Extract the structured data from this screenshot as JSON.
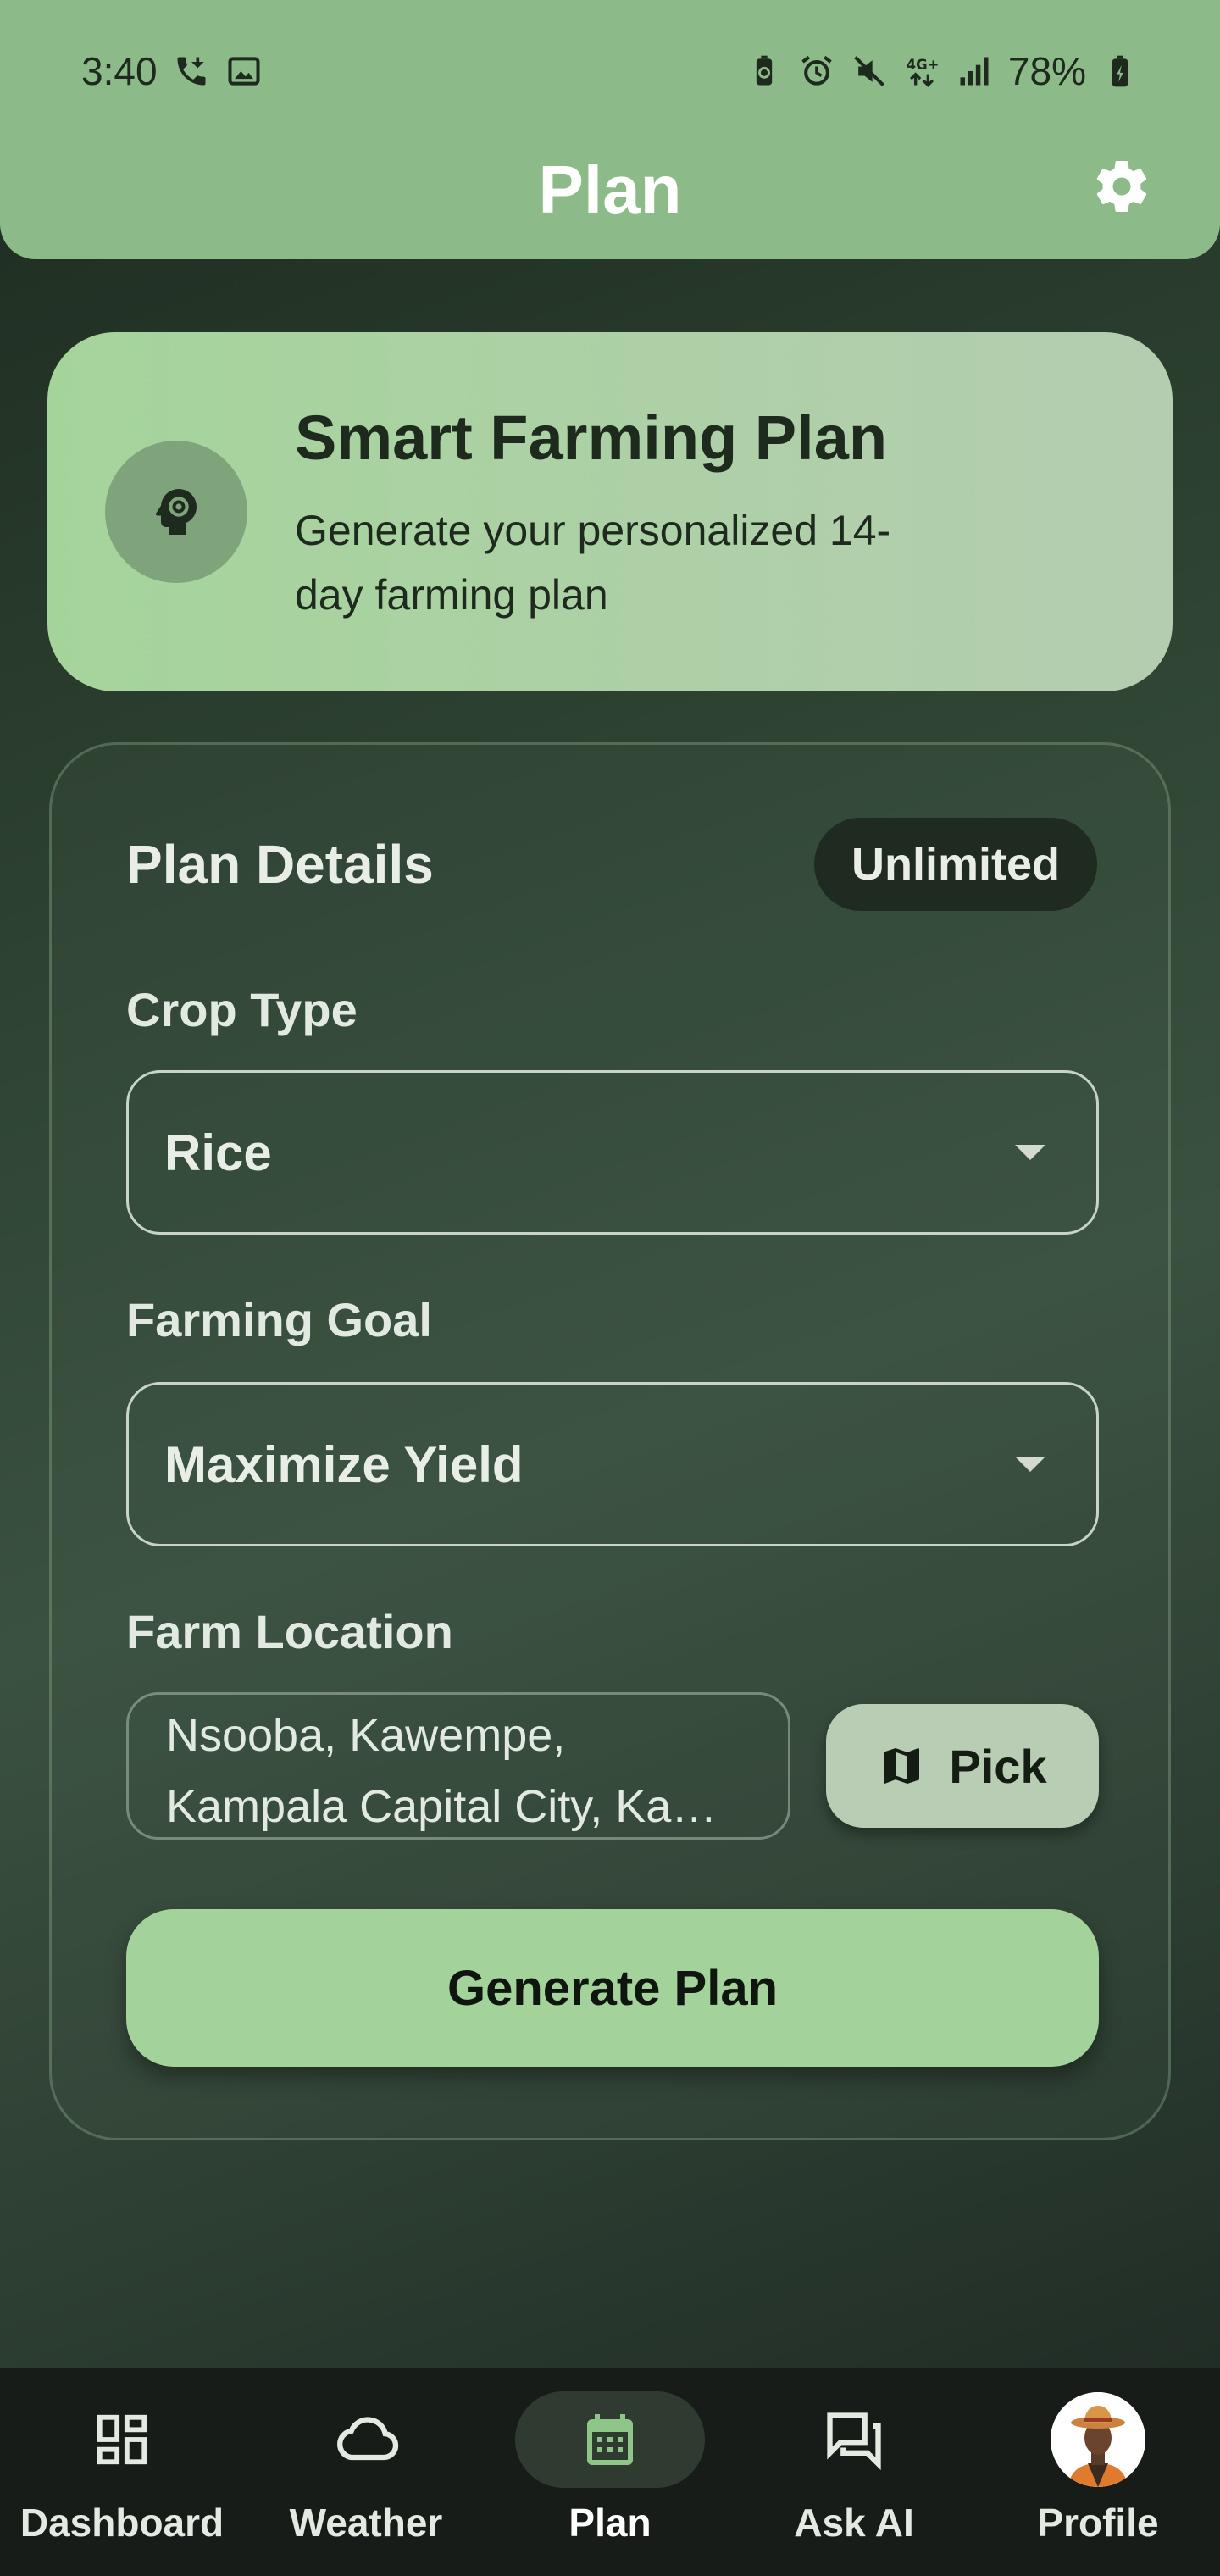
{
  "status_bar": {
    "time": "3:40",
    "battery": "78%",
    "icons": [
      "call-forward-icon",
      "image-icon",
      "battery-saver-icon",
      "alarm-icon",
      "mute-icon",
      "4g-icon",
      "signal-icon",
      "battery-charging-icon"
    ]
  },
  "header": {
    "title": "Plan",
    "settings_icon": "gear-icon"
  },
  "hero": {
    "title": "Smart Farming Plan",
    "subtitle": "Generate your personalized 14-day farming plan",
    "icon": "head-gear-icon"
  },
  "plan_details": {
    "title": "Plan Details",
    "badge": "Unlimited",
    "crop_type": {
      "label": "Crop Type",
      "value": "Rice"
    },
    "farming_goal": {
      "label": "Farming Goal",
      "value": "Maximize Yield"
    },
    "farm_location": {
      "label": "Farm Location",
      "value_line1": "Nsooba, Kawempe,",
      "value_line2": "Kampala Capital City, Ka…",
      "pick_label": "Pick",
      "pick_icon": "map-icon"
    },
    "generate_label": "Generate Plan"
  },
  "bottom_nav": {
    "items": [
      {
        "label": "Dashboard",
        "icon": "dashboard-icon",
        "active": false
      },
      {
        "label": "Weather",
        "icon": "cloud-icon",
        "active": false
      },
      {
        "label": "Plan",
        "icon": "calendar-icon",
        "active": true
      },
      {
        "label": "Ask AI",
        "icon": "chat-icon",
        "active": false
      },
      {
        "label": "Profile",
        "icon": "avatar",
        "active": false
      }
    ]
  },
  "colors": {
    "header": "#8dba89",
    "accent": "#a3d39a",
    "badge_bg": "#1f2a20",
    "nav_bg": "#171c18"
  }
}
